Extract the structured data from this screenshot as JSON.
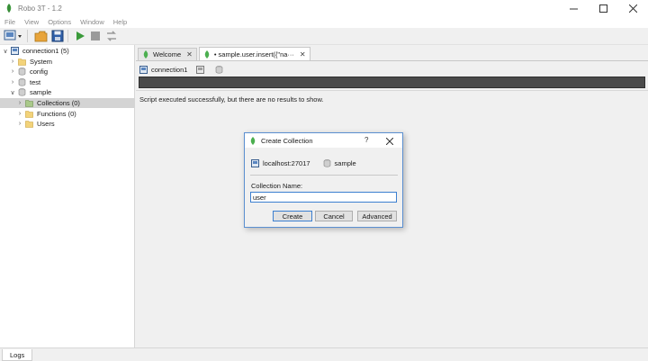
{
  "window": {
    "title": "Robo 3T - 1.2",
    "controls": [
      "minimize-icon",
      "maximize-icon",
      "close-icon"
    ]
  },
  "menu": [
    "File",
    "View",
    "Options",
    "Window",
    "Help"
  ],
  "toolbar": {
    "icons": [
      "connect-icon",
      "open-folder-icon",
      "save-icon",
      "execute-icon",
      "stop-icon",
      "refresh-icon"
    ]
  },
  "sidebar": {
    "items": [
      {
        "label": "connection1 (5)",
        "icon": "server-icon",
        "expanded": true
      },
      {
        "label": "System",
        "icon": "folder-icon"
      },
      {
        "label": "config",
        "icon": "database-icon"
      },
      {
        "label": "test",
        "icon": "database-icon"
      },
      {
        "label": "sample",
        "icon": "database-icon",
        "expanded": true
      },
      {
        "label": "Collections (0)",
        "icon": "folder-icon",
        "selected": true
      },
      {
        "label": "Functions (0)",
        "icon": "folder-icon"
      },
      {
        "label": "Users",
        "icon": "folder-icon"
      }
    ]
  },
  "tabs": [
    {
      "label": "Welcome",
      "icon": "mongo-leaf-icon",
      "active": false
    },
    {
      "label": "• sample.user.insert({\"na···",
      "icon": "mongo-leaf-icon",
      "active": true
    }
  ],
  "editor": {
    "connection_label": "connection1",
    "result_text": "Script executed successfully, but there are no results to show."
  },
  "logs": {
    "label": "Logs"
  },
  "dialog": {
    "title": "Create Collection",
    "help": "?",
    "server": "localhost:27017",
    "database": "sample",
    "field_label": "Collection Name:",
    "field_value": "user",
    "buttons": {
      "create": "Create",
      "cancel": "Cancel",
      "advanced": "Advanced"
    }
  },
  "colors": {
    "accent": "#3c7fd0",
    "mongo_green": "#4caf50",
    "selected_row": "#d4d4d4",
    "query_bar": "#4a4a4a"
  }
}
